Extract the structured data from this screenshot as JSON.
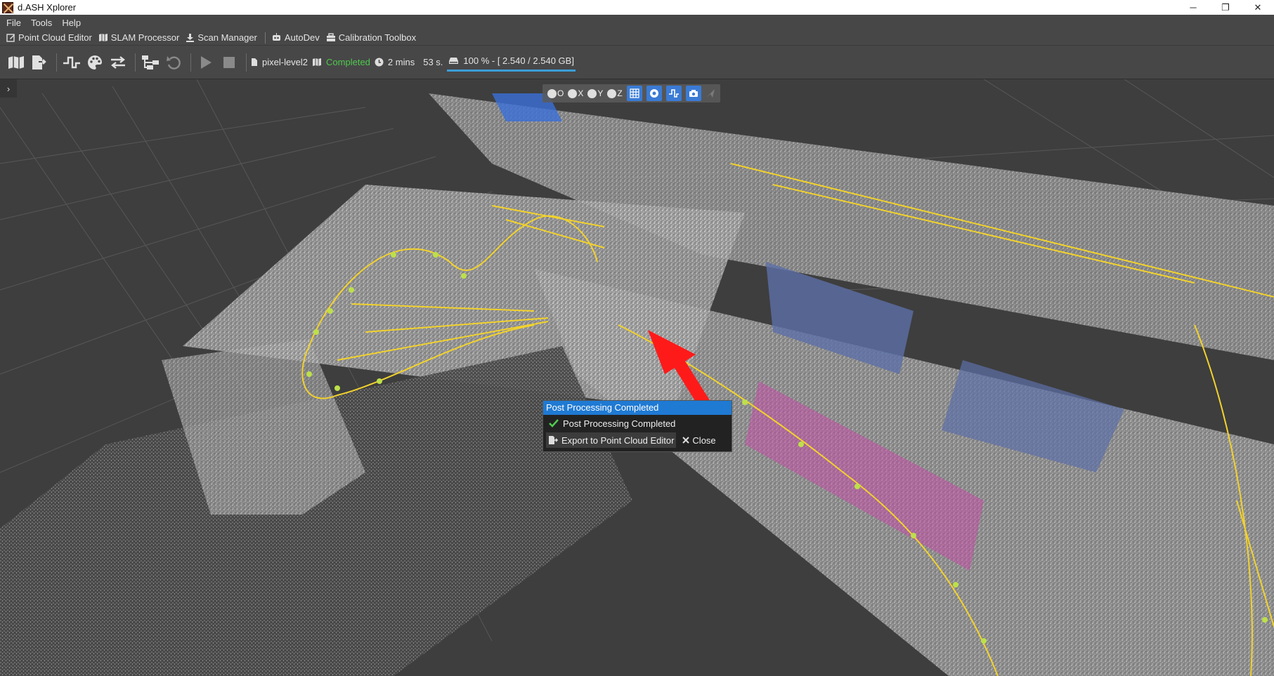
{
  "window": {
    "title": "d.ASH Xplorer",
    "controls": {
      "minimize": "─",
      "restore": "❐",
      "close": "✕"
    }
  },
  "menu": {
    "items": [
      "File",
      "Tools",
      "Help"
    ]
  },
  "modules": {
    "point_cloud_editor": "Point Cloud Editor",
    "slam_processor": "SLAM Processor",
    "scan_manager": "Scan Manager",
    "autodev": "AutoDev",
    "calibration_toolbox": "Calibration Toolbox"
  },
  "toolbar": {
    "project_name": "pixel-level2",
    "status": "Completed",
    "duration": "2 mins",
    "seconds": "53 s.",
    "memory": "100 % - [ 2.540 / 2.540 GB]",
    "memory_fraction": 1.0
  },
  "view_toolbar": {
    "origin": "O",
    "x": "X",
    "y": "Y",
    "z": "Z"
  },
  "popup": {
    "title": "Post Processing Completed",
    "message": "Post Processing Completed",
    "export_label": "Export to Point Cloud Editor",
    "close_label": "Close"
  },
  "colors": {
    "accent": "#1f7ad3",
    "status_ok": "#4ec94e",
    "trajectory": "#f2d22c",
    "arrow": "#ff1a1a"
  }
}
